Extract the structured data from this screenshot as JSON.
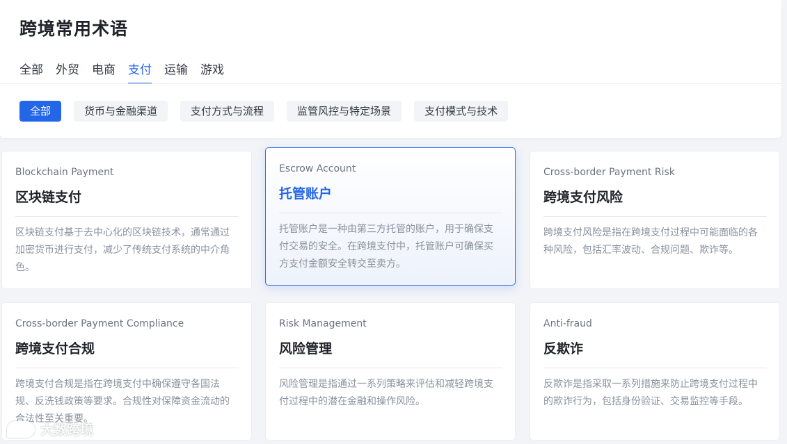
{
  "header": {
    "title": "跨境常用术语",
    "tabs": [
      {
        "label": "全部"
      },
      {
        "label": "外贸"
      },
      {
        "label": "电商"
      },
      {
        "label": "支付",
        "active": true
      },
      {
        "label": "运输"
      },
      {
        "label": "游戏"
      }
    ],
    "filters": [
      {
        "label": "全部",
        "active": true
      },
      {
        "label": "货币与金融渠道"
      },
      {
        "label": "支付方式与流程"
      },
      {
        "label": "监管风控与特定场景"
      },
      {
        "label": "支付模式与技术"
      }
    ]
  },
  "cards": [
    {
      "en": "Blockchain Payment",
      "zh": "区块链支付",
      "desc": "区块链支付基于去中心化的区块链技术，通常通过加密货币进行支付，减少了传统支付系统的中介角色。"
    },
    {
      "en": "Escrow Account",
      "zh": "托管账户",
      "desc": "托管账户是一种由第三方托管的账户，用于确保支付交易的安全。在跨境支付中，托管账户可确保买方支付金额安全转交至卖方。",
      "active": true
    },
    {
      "en": "Cross-border Payment Risk",
      "zh": "跨境支付风险",
      "desc": "跨境支付风险是指在跨境支付过程中可能面临的各种风险，包括汇率波动、合规问题、欺诈等。"
    },
    {
      "en": "Cross-border Payment Compliance",
      "zh": "跨境支付合规",
      "desc": "跨境支付合规是指在跨境支付中确保遵守各国法规、反洗钱政策等要求。合规性对保障资金流动的合法性至关重要。"
    },
    {
      "en": "Risk Management",
      "zh": "风险管理",
      "desc": "风险管理是指通过一系列策略来评估和减轻跨境支付过程中的潜在金融和操作风险。"
    },
    {
      "en": "Anti-fraud",
      "zh": "反欺诈",
      "desc": "反欺诈是指采取一系列措施来防止跨境支付过程中的欺诈行为，包括身份验证、交易监控等手段。"
    }
  ],
  "watermark": {
    "text": "大数跨境",
    "icon": "speech-bubble-logo-icon"
  },
  "colors": {
    "accent": "#2466e8",
    "background": "#f2f4f8"
  }
}
